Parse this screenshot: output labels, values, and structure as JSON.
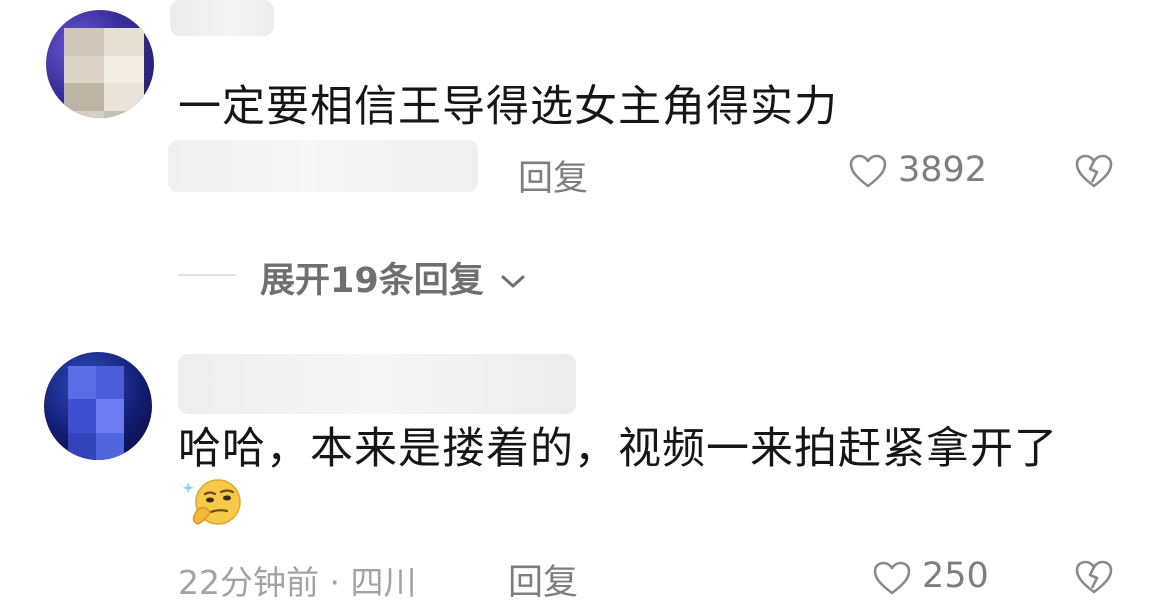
{
  "comments": [
    {
      "text": "一定要相信王导得选女主角得实力",
      "reply_label": "回复",
      "likes": "3892"
    },
    {
      "text": "哈哈，本来是搂着的，视频一来拍赶紧拿开了",
      "emoji": "thinking-face-emoji",
      "meta": "22分钟前 · 四川",
      "reply_label": "回复",
      "likes": "250"
    }
  ],
  "expand_replies": {
    "label": "展开19条回复"
  },
  "icons": {
    "like": "heart-outline-icon",
    "dislike": "broken-heart-icon",
    "expand": "chevron-down-icon"
  },
  "colors": {
    "primary_text": "#161616",
    "secondary_text": "#7e7e7e",
    "meta_text": "#a3a3a3"
  }
}
